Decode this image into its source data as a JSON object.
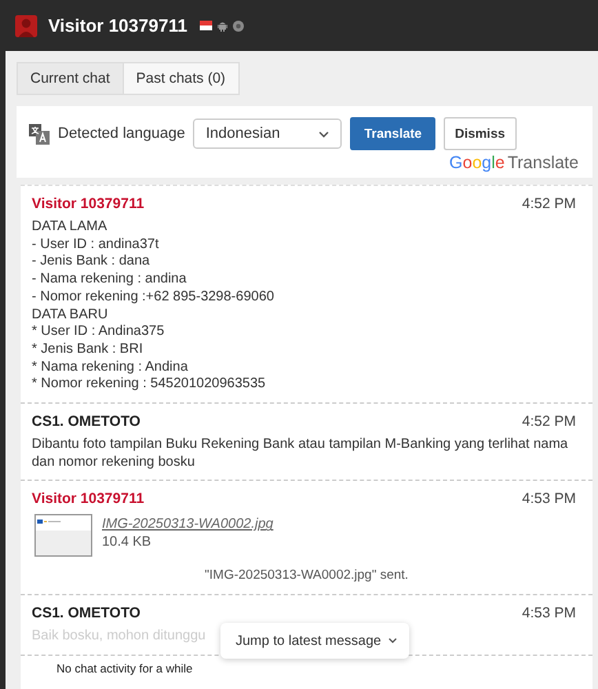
{
  "window": {
    "title": "Visitor 10379711"
  },
  "tabs": [
    {
      "label": "Current chat",
      "selected": true
    },
    {
      "label": "Past chats (0)",
      "selected": false
    }
  ],
  "translate": {
    "label": "Detected language",
    "language": "Indonesian",
    "translate_button": "Translate",
    "dismiss_button": "Dismiss",
    "brand": [
      "G",
      "o",
      "o",
      "g",
      "l",
      "e"
    ],
    "brand_suffix": "Translate"
  },
  "messages": [
    {
      "sender": "Visitor 10379711",
      "color": "#c8102e",
      "time": "4:52 PM",
      "kind": "text",
      "lines": [
        "DATA LAMA",
        "- User ID : andina37t",
        "- Jenis Bank : dana",
        "- Nama rekening : andina",
        "- Nomor rekening :+62 895-3298-69060",
        "DATA BARU",
        "* User ID : Andina375",
        "* Jenis Bank : BRI",
        "* Nama rekening : Andina",
        "* Nomor rekening : 545201020963535"
      ],
      "faded": false
    },
    {
      "sender": "CS1. OMETOTO",
      "color": "#222222",
      "time": "4:52 PM",
      "kind": "text",
      "lines": [
        "Dibantu foto tampilan Buku Rekening Bank atau tampilan M-Banking yang terlihat nama dan nomor rekening bosku"
      ],
      "faded": false
    },
    {
      "sender": "Visitor 10379711",
      "color": "#c8102e",
      "time": "4:53 PM",
      "kind": "file",
      "file_name": "IMG-20250313-WA0002.jpg",
      "file_size": "10.4 KB",
      "note": "\"IMG-20250313-WA0002.jpg\" sent."
    },
    {
      "sender": "CS1. OMETOTO",
      "color": "#222222",
      "time": "4:53 PM",
      "kind": "text",
      "lines": [
        "Baik bosku, mohon ditunggu"
      ],
      "faded": true
    }
  ],
  "jump_button": "Jump to latest message",
  "activity_notice": "No chat activity for a while"
}
